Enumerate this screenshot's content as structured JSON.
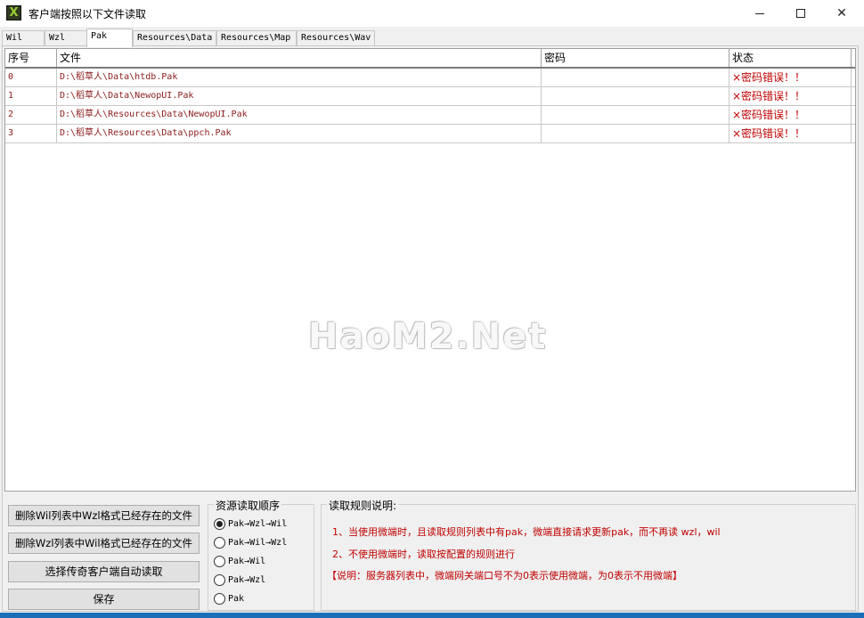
{
  "window": {
    "title": "客户端按照以下文件读取",
    "icon_glyph": "X",
    "minimize_glyph": "",
    "maximize_glyph": "",
    "close_glyph": "✕"
  },
  "tabs": [
    {
      "label": "Wil"
    },
    {
      "label": "Wzl"
    },
    {
      "label": "Pak"
    },
    {
      "label": "Resources\\Data"
    },
    {
      "label": "Resources\\Map"
    },
    {
      "label": "Resources\\Wav"
    }
  ],
  "active_tab": "Pak",
  "table": {
    "columns": [
      "序号",
      "文件",
      "密码",
      "状态"
    ],
    "rows": [
      {
        "idx": "0",
        "file": "D:\\稻草人\\Data\\htdb.Pak",
        "password": "",
        "status": "×密码错误！！"
      },
      {
        "idx": "1",
        "file": "D:\\稻草人\\Data\\NewopUI.Pak",
        "password": "",
        "status": "×密码错误！！"
      },
      {
        "idx": "2",
        "file": "D:\\稻草人\\Resources\\Data\\NewopUI.Pak",
        "password": "",
        "status": "×密码错误！！"
      },
      {
        "idx": "3",
        "file": "D:\\稻草人\\Resources\\Data\\ppch.Pak",
        "password": "",
        "status": "×密码错误！！"
      }
    ]
  },
  "watermark": "HaoM2.Net",
  "buttons": {
    "delete_wil": "删除Wil列表中Wzl格式已经存在的文件",
    "delete_wzl": "删除Wzl列表中Wil格式已经存在的文件",
    "auto_read": "选择传奇客户端自动读取",
    "save": "保存"
  },
  "resource_order": {
    "legend": "资源读取顺序",
    "options": [
      {
        "label": "Pak→Wzl→Wil",
        "selected": true
      },
      {
        "label": "Pak→Wil→Wzl",
        "selected": false
      },
      {
        "label": "Pak→Wil",
        "selected": false
      },
      {
        "label": "Pak→Wzl",
        "selected": false
      },
      {
        "label": "Pak",
        "selected": false
      }
    ]
  },
  "rules": {
    "legend": "读取规则说明:",
    "line1": "1、当使用微端时，且读取规则列表中有pak，微端直接请求更新pak，而不再读 wzl，wil",
    "line2": "2、不使用微端时，读取按配置的规则进行",
    "note": "【说明：服务器列表中，微端网关端口号不为0表示使用微端，为0表示不用微端】"
  },
  "colors": {
    "file_text": "#8b1a1a",
    "status_text": "#c00000",
    "taskbar": "#1a6fb8"
  }
}
